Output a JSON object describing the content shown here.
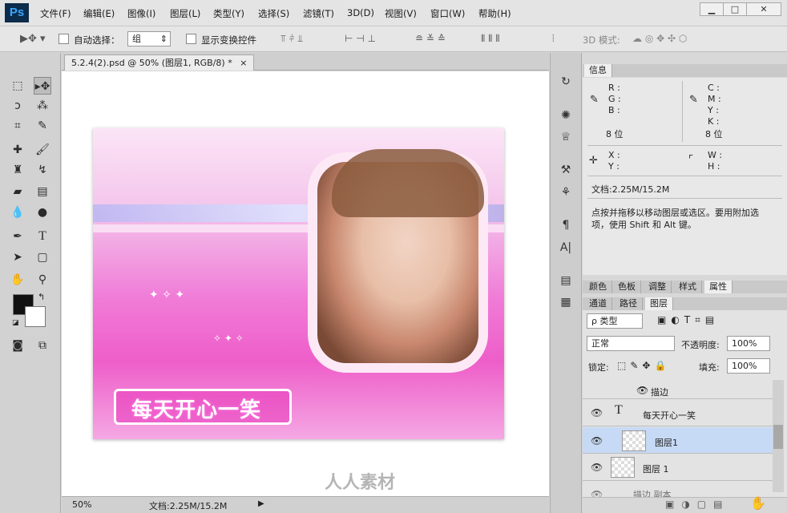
{
  "app": {
    "logo": "Ps"
  },
  "menu": [
    "文件(F)",
    "编辑(E)",
    "图像(I)",
    "图层(L)",
    "类型(Y)",
    "选择(S)",
    "滤镜(T)",
    "3D(D)",
    "视图(V)",
    "窗口(W)",
    "帮助(H)"
  ],
  "window_controls": [
    "▁",
    "□",
    "✕"
  ],
  "options": {
    "auto_select_label": "自动选择：",
    "auto_select_value": "组",
    "show_transform_label": "显示变换控件",
    "mode_3d_label": "3D 模式:"
  },
  "document": {
    "tab_title": "5.2.4(2).psd @ 50% (图层1, RGB/8) *",
    "tab_close": "×",
    "image_caption": "每天开心一笑",
    "watermark": "人人素材"
  },
  "status": {
    "zoom": "50%",
    "doc_size": "文档:2.25M/15.2M"
  },
  "info_panel": {
    "tab": "信息",
    "r": "R :",
    "g": "G :",
    "b": "B :",
    "c": "C :",
    "m": "M :",
    "y": "Y :",
    "k": "K :",
    "bit_left": "8 位",
    "bit_right": "8 位",
    "x": "X :",
    "yy": "Y :",
    "w": "W :",
    "h": "H :",
    "doc": "文档:2.25M/15.2M",
    "hint": "点按并拖移以移动图层或选区。要用附加选项，使用 Shift 和 Alt 键。"
  },
  "panel_tabs_1": [
    "颜色",
    "色板",
    "调整",
    "样式",
    "属性"
  ],
  "panel_tabs_2": [
    "通道",
    "路径",
    "图层"
  ],
  "layers": {
    "filter": "ρ 类型",
    "blend": "正常",
    "opacity_label": "不透明度:",
    "opacity": "100%",
    "lock_label": "锁定:",
    "fill_label": "填充:",
    "fill": "100%",
    "items": [
      {
        "name": "描边",
        "kind": "effect"
      },
      {
        "name": "每天开心一笑",
        "kind": "text"
      },
      {
        "name": "图层1",
        "kind": "image",
        "selected": true
      },
      {
        "name": "图层 1",
        "kind": "image"
      },
      {
        "name": "描边 副本",
        "kind": "image"
      }
    ]
  },
  "colors": {
    "accent": "#39a6ff",
    "selected_layer": "#c7daf5"
  }
}
